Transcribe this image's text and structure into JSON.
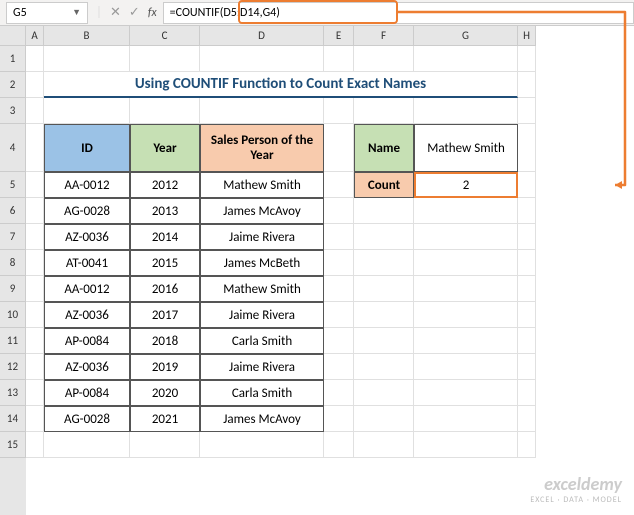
{
  "namebox": "G5",
  "formula": "=COUNTIF(D5:D14,G4)",
  "title": "Using COUNTIF Function to Count Exact Names",
  "columns": [
    "A",
    "B",
    "C",
    "D",
    "E",
    "F",
    "G",
    "H"
  ],
  "rows": [
    "1",
    "2",
    "3",
    "4",
    "5",
    "6",
    "7",
    "8",
    "9",
    "10",
    "11",
    "12",
    "13",
    "14",
    "15"
  ],
  "headers": {
    "id": "ID",
    "year": "Year",
    "sp": "Sales Person of the Year"
  },
  "side": {
    "name_lbl": "Name",
    "name_val": "Mathew Smith",
    "count_lbl": "Count",
    "count_val": "2"
  },
  "data": [
    {
      "id": "AA-0012",
      "year": "2012",
      "sp": "Mathew Smith"
    },
    {
      "id": "AG-0028",
      "year": "2013",
      "sp": "James McAvoy"
    },
    {
      "id": "AZ-0036",
      "year": "2014",
      "sp": "Jaime Rivera"
    },
    {
      "id": "AT-0041",
      "year": "2015",
      "sp": "James McBeth"
    },
    {
      "id": "AA-0012",
      "year": "2016",
      "sp": "Mathew Smith"
    },
    {
      "id": "AZ-0036",
      "year": "2017",
      "sp": "Jaime Rivera"
    },
    {
      "id": "AP-0084",
      "year": "2018",
      "sp": "Carla Smith"
    },
    {
      "id": "AZ-0036",
      "year": "2019",
      "sp": "Jaime Rivera"
    },
    {
      "id": "AP-0084",
      "year": "2020",
      "sp": "Carla Smith"
    },
    {
      "id": "AG-0028",
      "year": "2021",
      "sp": "James McAvoy"
    }
  ],
  "watermark": {
    "big": "exceldemy",
    "small": "EXCEL · DATA · MODEL"
  }
}
